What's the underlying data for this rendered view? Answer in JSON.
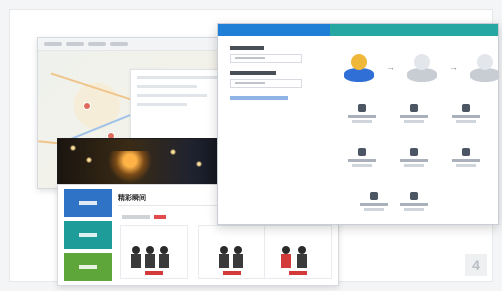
{
  "corner_badge": "4",
  "content_window": {
    "section_title": "精彩瞬间"
  },
  "app_window": {
    "tabs": [
      {
        "label": "",
        "state": "active"
      },
      {
        "label": "",
        "state": "inactive"
      }
    ]
  },
  "colors": {
    "tab_active": "#1f7fd6",
    "tab_inactive": "#27a7a2",
    "tile_blue": "#2f73c7",
    "tile_teal": "#1e9c9a",
    "tile_green": "#5ea63a",
    "accent_red": "#d33a3a"
  },
  "icons": [
    "arrow-right-icon",
    "map-pin-icon",
    "person-icon"
  ]
}
